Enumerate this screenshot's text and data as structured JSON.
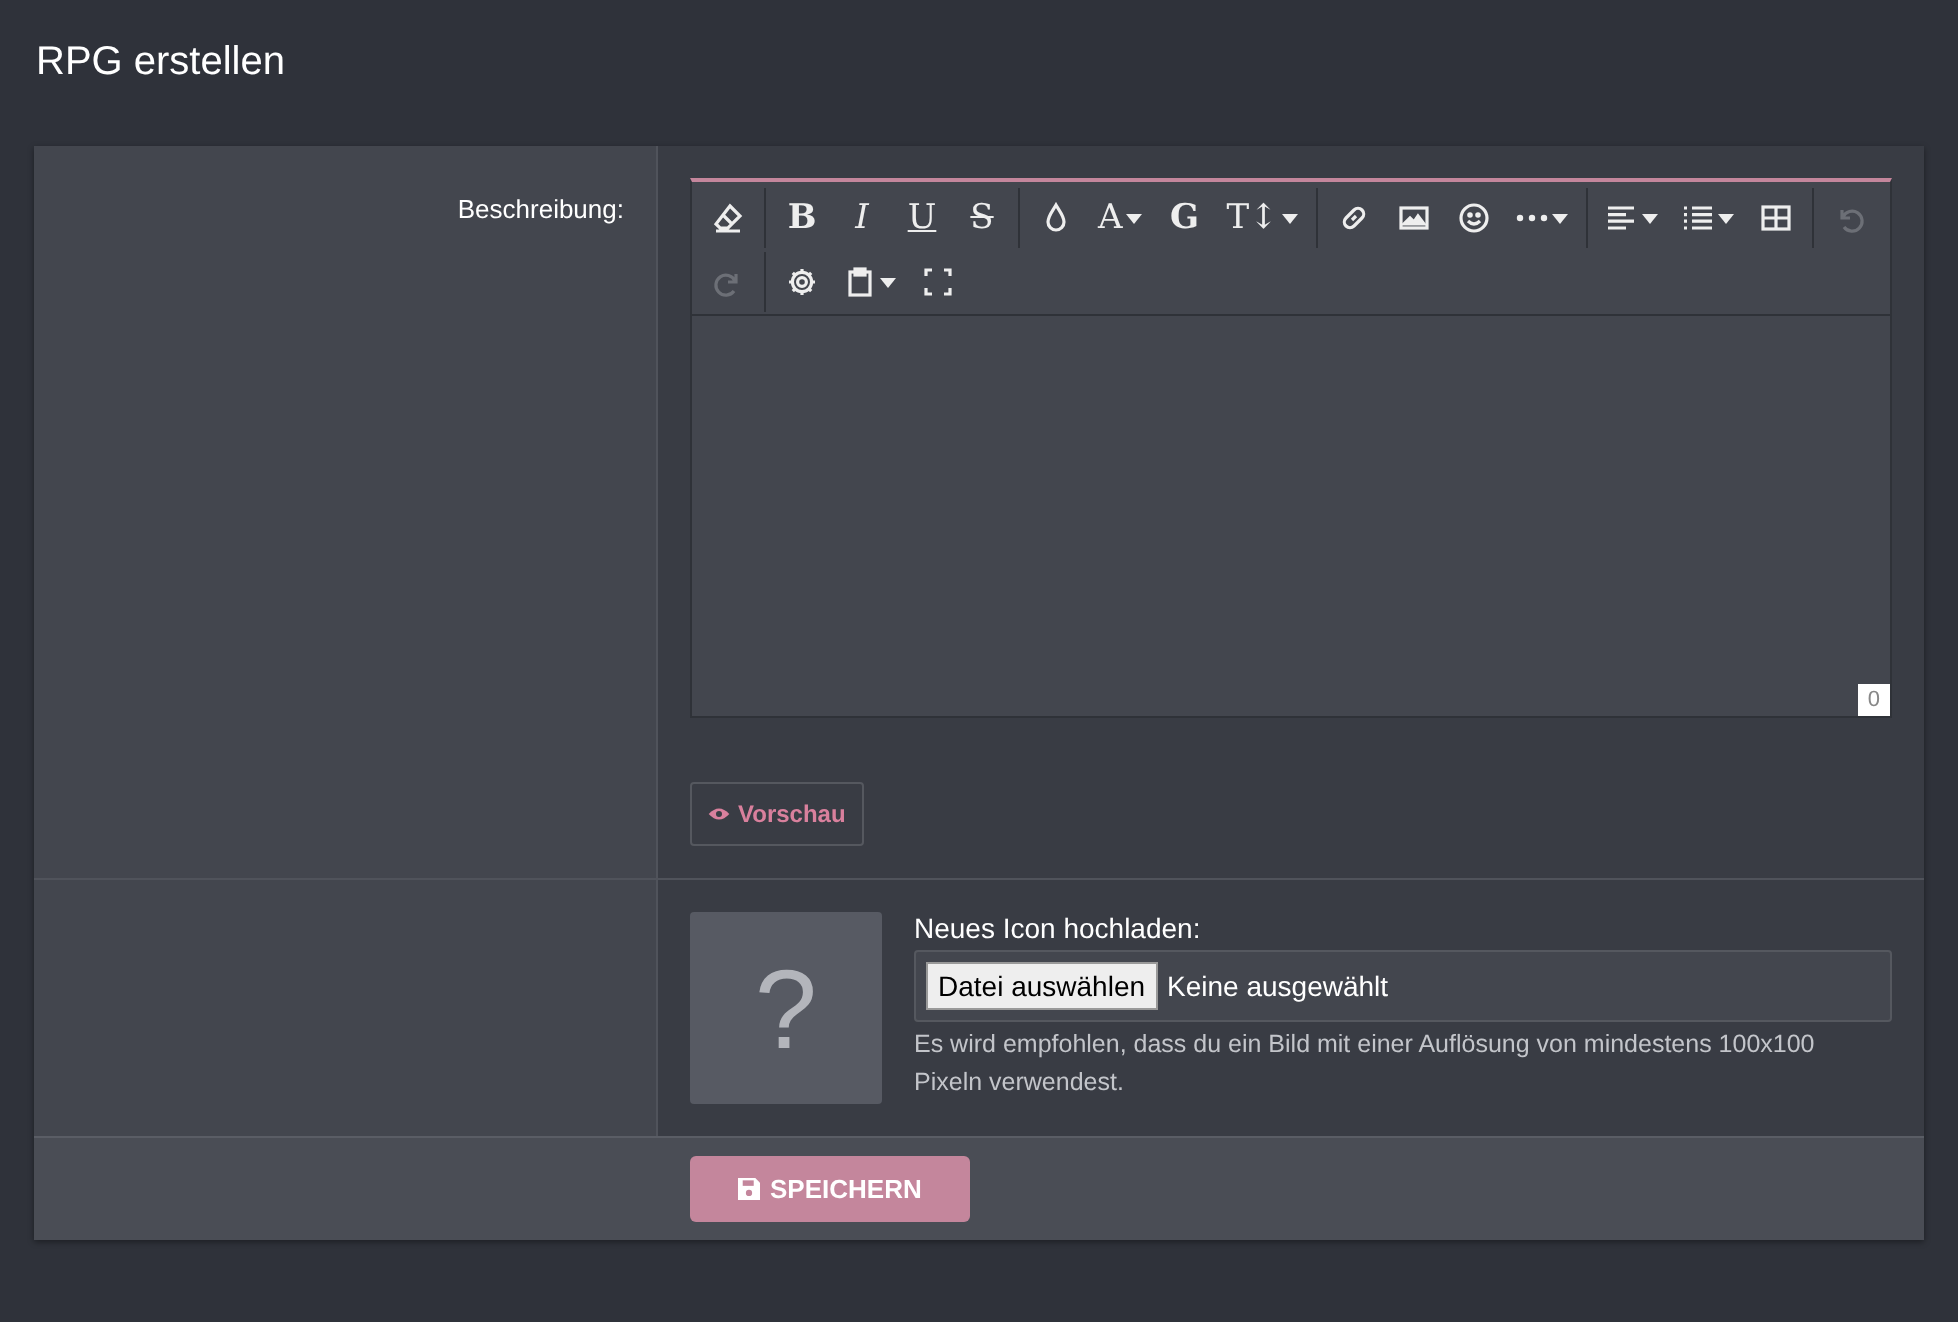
{
  "page_title": "RPG erstellen",
  "description": {
    "label": "Beschreibung:",
    "toolbar": [
      [
        [
          {
            "kind": "eraser",
            "disabled": false
          }
        ],
        [
          {
            "kind": "bold",
            "glyph": "B",
            "disabled": false
          },
          {
            "kind": "italic",
            "glyph": "I",
            "disabled": false
          },
          {
            "kind": "underline",
            "glyph": "U",
            "disabled": false
          },
          {
            "kind": "strike",
            "glyph": "S",
            "disabled": false
          }
        ],
        [
          {
            "kind": "drop",
            "disabled": false
          },
          {
            "kind": "plain",
            "glyph": "A",
            "caret": true,
            "disabled": false
          },
          {
            "kind": "bold",
            "glyph": "G",
            "disabled": false
          },
          {
            "kind": "plain",
            "glyph": "T↕",
            "caret": true,
            "disabled": false
          }
        ],
        [
          {
            "kind": "link",
            "disabled": false
          },
          {
            "kind": "image",
            "disabled": false
          },
          {
            "kind": "smile",
            "disabled": false
          },
          {
            "kind": "more",
            "caret": true,
            "disabled": false
          }
        ],
        [
          {
            "kind": "align",
            "caret": true,
            "disabled": false
          },
          {
            "kind": "list",
            "caret": true,
            "disabled": false
          },
          {
            "kind": "table",
            "disabled": false
          }
        ],
        [
          {
            "kind": "undo",
            "disabled": true
          }
        ]
      ],
      [
        [
          {
            "kind": "redo",
            "disabled": true
          }
        ],
        [
          {
            "kind": "gear",
            "disabled": false
          },
          {
            "kind": "clipboard",
            "caret": true,
            "disabled": false
          },
          {
            "kind": "fullscreen",
            "disabled": false
          }
        ]
      ]
    ],
    "char_count": "0",
    "preview_button": "Vorschau"
  },
  "icon_upload": {
    "label": "Neues Icon hochladen:",
    "placeholder_glyph": "?",
    "choose_button": "Datei auswählen",
    "file_status": "Keine ausgewählt",
    "hint": "Es wird empfohlen, dass du ein Bild mit einer Auflösung von mindestens 100x100 Pixeln verwendest."
  },
  "save_button": "SPEICHERN"
}
